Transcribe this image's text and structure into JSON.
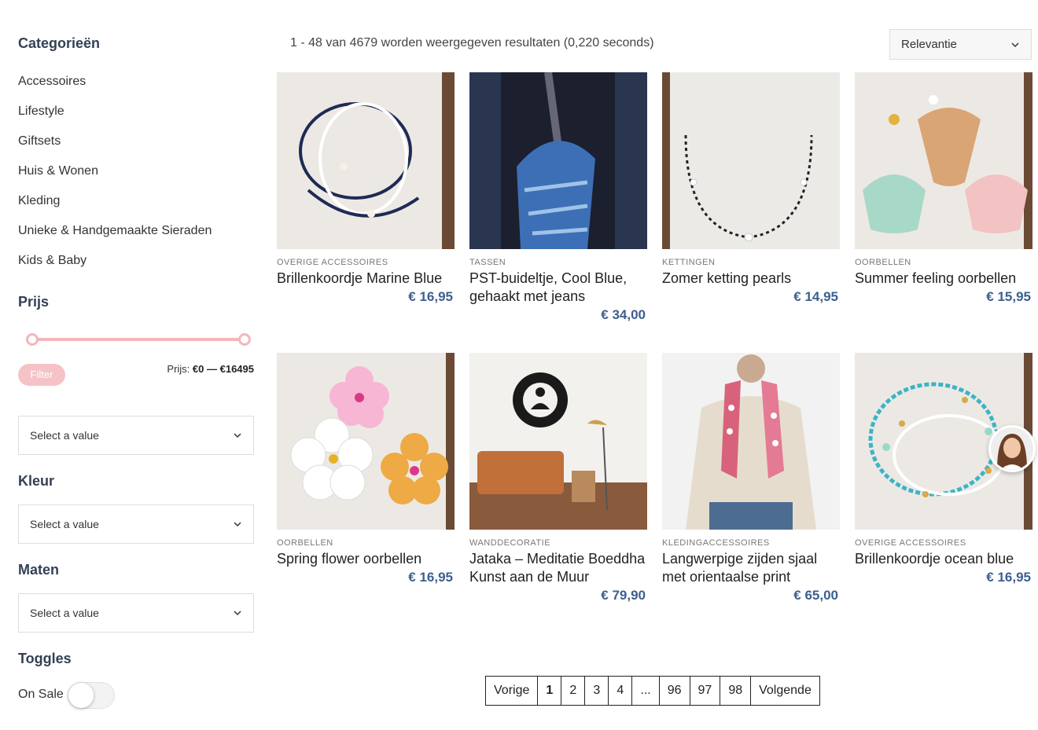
{
  "sidebar": {
    "categories_heading": "Categorieën",
    "categories": [
      "Accessoires",
      "Lifestyle",
      "Giftsets",
      "Huis & Wonen",
      "Kleding",
      "Unieke & Handgemaakte Sieraden",
      "Kids & Baby"
    ],
    "price_heading": "Prijs",
    "filter_label": "Filter",
    "price_prefix": "Prijs:",
    "price_range": "€0 — €16495",
    "price_min": 0,
    "price_max": 16495,
    "select_placeholder_1": "Select a value",
    "color_heading": "Kleur",
    "select_placeholder_2": "Select a value",
    "sizes_heading": "Maten",
    "select_placeholder_3": "Select a value",
    "toggles_heading": "Toggles",
    "on_sale_label": "On Sale",
    "on_sale_enabled": false
  },
  "results": {
    "summary": "1 - 48 van 4679 worden weergegeven resultaten (0,220 seconds)",
    "sort_value": "Relevantie"
  },
  "products": [
    {
      "category": "OVERIGE ACCESSOIRES",
      "name": "Brillenkoordje Marine Blue",
      "price": "€ 16,95"
    },
    {
      "category": "TASSEN",
      "name": "PST-buideltje, Cool Blue, gehaakt met jeans",
      "price": "€ 34,00"
    },
    {
      "category": "KETTINGEN",
      "name": "Zomer ketting pearls",
      "price": "€ 14,95"
    },
    {
      "category": "OORBELLEN",
      "name": "Summer feeling oorbellen",
      "price": "€ 15,95"
    },
    {
      "category": "OORBELLEN",
      "name": "Spring flower oorbellen",
      "price": "€ 16,95"
    },
    {
      "category": "WANDDECORATIE",
      "name": "Jataka – Meditatie Boeddha Kunst aan de Muur",
      "price": "€ 79,90"
    },
    {
      "category": "KLEDINGACCESSOIRES",
      "name": "Langwerpige zijden sjaal met orientaalse print",
      "price": "€ 65,00"
    },
    {
      "category": "OVERIGE ACCESSOIRES",
      "name": "Brillenkoordje ocean blue",
      "price": "€ 16,95"
    }
  ],
  "pagination": {
    "prev": "Vorige",
    "pages": [
      "1",
      "2",
      "3",
      "4",
      "...",
      "96",
      "97",
      "98"
    ],
    "current": "1",
    "next": "Volgende"
  },
  "colors": {
    "heading": "#334155",
    "price": "#3b5f8f",
    "slider": "#f2b7bb",
    "filter_button": "#f5c3c7"
  }
}
